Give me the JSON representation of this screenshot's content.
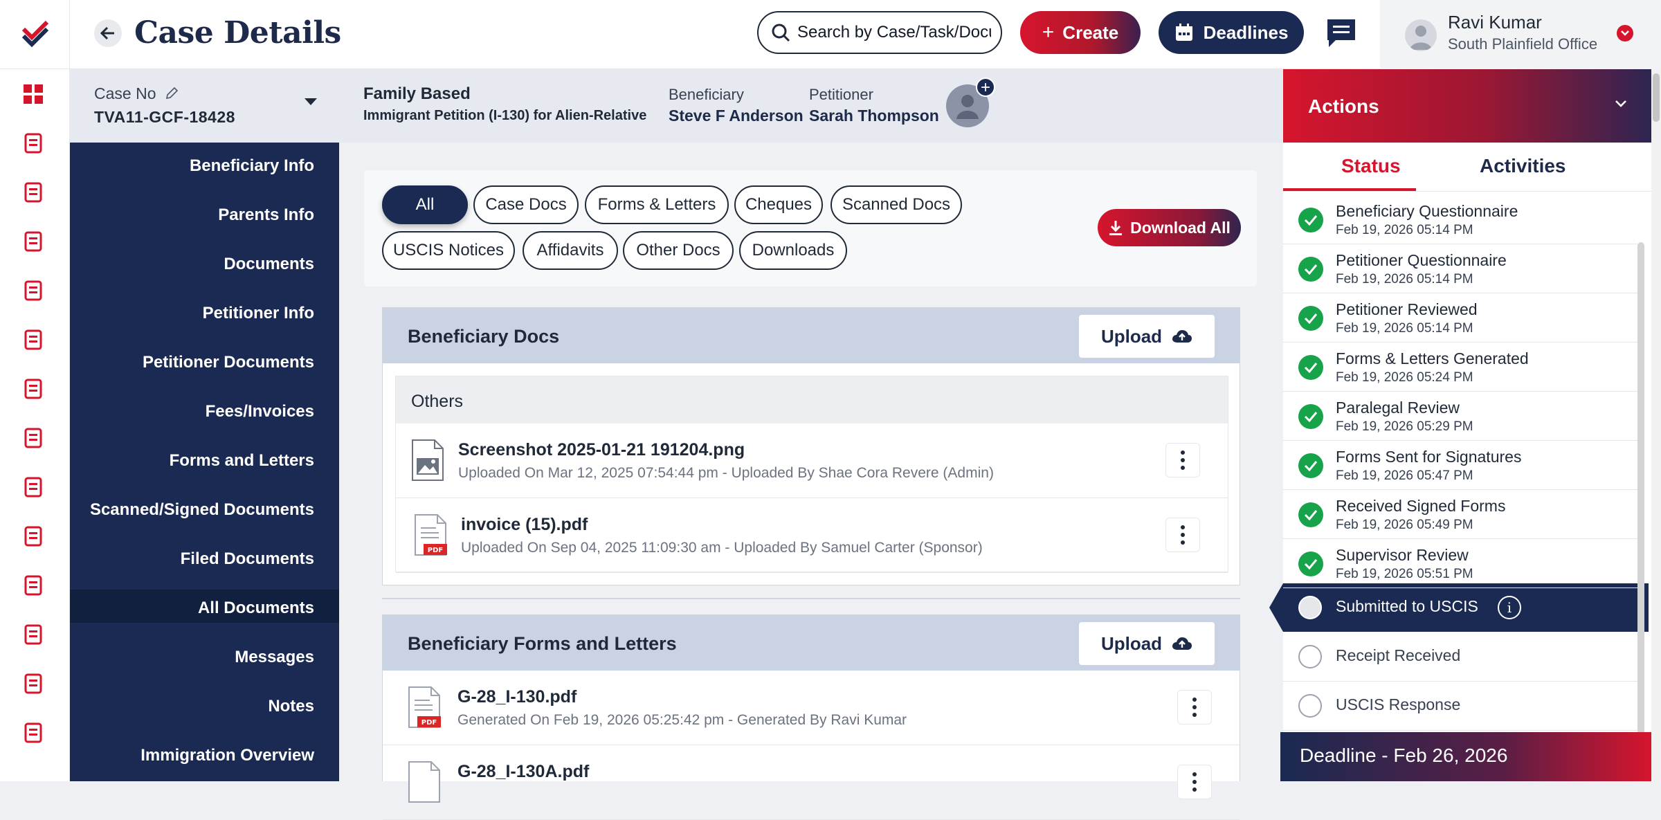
{
  "app": {
    "page_title": "Case Details",
    "search_placeholder": "Search by Case/Task/Document",
    "create_label": "Create",
    "deadlines_label": "Deadlines",
    "user_name": "Ravi Kumar",
    "user_office": "South Plainfield Office"
  },
  "case": {
    "case_no_label": "Case No",
    "case_no": "TVA11-GCF-18428",
    "type": "Family Based",
    "subtype": "Immigrant Petition (I-130) for Alien-Relative",
    "beneficiary_label": "Beneficiary",
    "beneficiary": "Steve F Anderson",
    "petitioner_label": "Petitioner",
    "petitioner": "Sarah Thompson"
  },
  "nav": {
    "items": [
      "Beneficiary Info",
      "Parents Info",
      "Documents",
      "Petitioner Info",
      "Petitioner Documents",
      "Fees/Invoices",
      "Forms and Letters",
      "Scanned/Signed Documents",
      "Filed Documents",
      "All Documents",
      "Messages",
      "Notes",
      "Immigration Overview"
    ],
    "active": "All Documents"
  },
  "filters": {
    "chips": [
      "All",
      "Case Docs",
      "Forms & Letters",
      "Cheques",
      "Scanned Docs",
      "USCIS Notices",
      "Affidavits",
      "Other Docs",
      "Downloads"
    ],
    "active": "All",
    "download_all": "Download All"
  },
  "sections": [
    {
      "title": "Beneficiary Docs",
      "upload_label": "Upload",
      "group_title": "Others",
      "files": [
        {
          "name": "Screenshot 2025-01-21 191204.png",
          "meta": "Uploaded On Mar 12, 2025 07:54:44 pm - Uploaded By Shae Cora Revere (Admin)",
          "kind": "image"
        },
        {
          "name": "invoice (15).pdf",
          "meta": "Uploaded On Sep 04, 2025 11:09:30 am - Uploaded By Samuel Carter (Sponsor)",
          "kind": "pdf"
        }
      ]
    },
    {
      "title": "Beneficiary Forms and Letters",
      "upload_label": "Upload",
      "files": [
        {
          "name": "G-28_I-130.pdf",
          "meta": "Generated On Feb 19, 2026 05:25:42 pm - Generated By Ravi Kumar",
          "kind": "pdf"
        },
        {
          "name": "G-28_I-130A.pdf",
          "meta": "",
          "kind": "pdf"
        }
      ]
    }
  ],
  "actions": {
    "title": "Actions",
    "tabs": [
      "Status",
      "Activities"
    ],
    "active_tab": "Status",
    "statuses": [
      {
        "name": "Beneficiary Questionnaire",
        "date": "Feb 19, 2026 05:14 PM",
        "done": true
      },
      {
        "name": "Petitioner Questionnaire",
        "date": "Feb 19, 2026 05:14 PM",
        "done": true
      },
      {
        "name": "Petitioner Reviewed",
        "date": "Feb 19, 2026 05:14 PM",
        "done": true
      },
      {
        "name": "Forms & Letters Generated",
        "date": "Feb 19, 2026 05:24 PM",
        "done": true
      },
      {
        "name": "Paralegal Review",
        "date": "Feb 19, 2026 05:29 PM",
        "done": true
      },
      {
        "name": "Forms Sent for Signatures",
        "date": "Feb 19, 2026 05:47 PM",
        "done": true
      },
      {
        "name": "Received Signed Forms",
        "date": "Feb 19, 2026 05:49 PM",
        "done": true
      },
      {
        "name": "Supervisor Review",
        "date": "Feb 19, 2026 05:51 PM",
        "done": true
      },
      {
        "name": "Submitted to USCIS",
        "date": "",
        "done": false
      },
      {
        "name": "Receipt Received",
        "date": "",
        "done": false
      },
      {
        "name": "USCIS Response",
        "date": "",
        "done": false
      }
    ],
    "current": "Submitted to USCIS",
    "deadline": "Deadline - Feb 26, 2026"
  },
  "colors": {
    "navy": "#1a2a52",
    "red": "#d6152d",
    "success": "#16a34a"
  }
}
